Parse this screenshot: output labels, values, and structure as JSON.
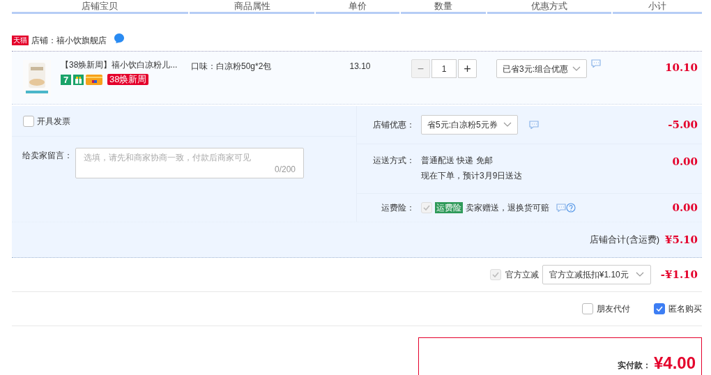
{
  "columns": [
    "店铺宝贝",
    "商品属性",
    "单价",
    "数量",
    "优惠方式",
    "小计"
  ],
  "shop": {
    "badge": "天猫",
    "name": "店铺：禧小饮旗舰店"
  },
  "item": {
    "title": "【38焕新周】禧小饮白凉粉儿...",
    "tags": [
      {
        "kind": "number",
        "text": "7"
      },
      {
        "kind": "gift"
      },
      {
        "kind": "card"
      },
      {
        "kind": "promo",
        "text": "38焕新周"
      }
    ],
    "attribute": "口味：白凉粉50g*2包",
    "price": "13.10",
    "minus": "−",
    "quantity": "1",
    "plus": "+",
    "minus_disabled": true,
    "discount": "已省3元:组合优惠",
    "subtotal": "10.10"
  },
  "invoice": {
    "label": "开具发票",
    "checked": false
  },
  "message": {
    "label": "给卖家留言：",
    "placeholder": "选填，请先和商家协商一致，付款后商家可见",
    "counter": "0/200"
  },
  "coupon": {
    "label": "店铺优惠：",
    "value": "省5元:白凉粉5元券",
    "amount": "-5.00"
  },
  "shipping": {
    "label": "运送方式：",
    "line1": "普通配送 快递 免邮",
    "line2": "现在下单，预计3月9日送达",
    "amount": "0.00"
  },
  "insurance": {
    "label": "运费险：",
    "checked": true,
    "disabled": true,
    "tag": "运费险",
    "text": "卖家赠送，退换货可赔",
    "amount": "0.00"
  },
  "shop_total": {
    "label": "店铺合计(含运费)",
    "amount": "¥5.10"
  },
  "official": {
    "checked": true,
    "disabled": true,
    "label": "官方立减",
    "value": "官方立减抵扣¥1.10元",
    "amount": "-¥1.10"
  },
  "options": [
    {
      "label": "朋友代付",
      "checked": false
    },
    {
      "label": "匿名购买",
      "checked": true
    }
  ],
  "payment": {
    "label": "实付款：",
    "amount": "¥4.00"
  }
}
